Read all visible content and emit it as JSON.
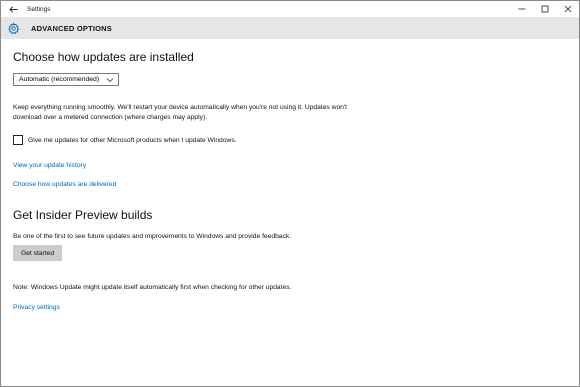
{
  "window": {
    "title": "Settings"
  },
  "header": {
    "title": "ADVANCED OPTIONS",
    "icon": "gear-icon"
  },
  "updates": {
    "heading": "Choose how updates are installed",
    "dropdown_value": "Automatic (recommended)",
    "description_line1": "Keep everything running smoothly. We'll restart your device automatically when you're not using it. Updates won't",
    "description_line2": "download over a metered connection (where charges may apply).",
    "checkbox_label": "Give me updates for other Microsoft products when I update Windows.",
    "checkbox_checked": false,
    "link_history": "View your update history",
    "link_delivery": "Choose how updates are delivered"
  },
  "insider": {
    "heading": "Get Insider Preview builds",
    "description": "Be one of the first to see future updates and improvements to Windows and provide feedback.",
    "button_label": "Get started"
  },
  "footer": {
    "note": "Note: Windows Update might update itself automatically first when checking for other updates.",
    "link_privacy": "Privacy settings"
  },
  "colors": {
    "link": "#0067b8",
    "accent": "#0067b8",
    "header_bg": "#e6e6e6",
    "button_bg": "#cccccc"
  }
}
